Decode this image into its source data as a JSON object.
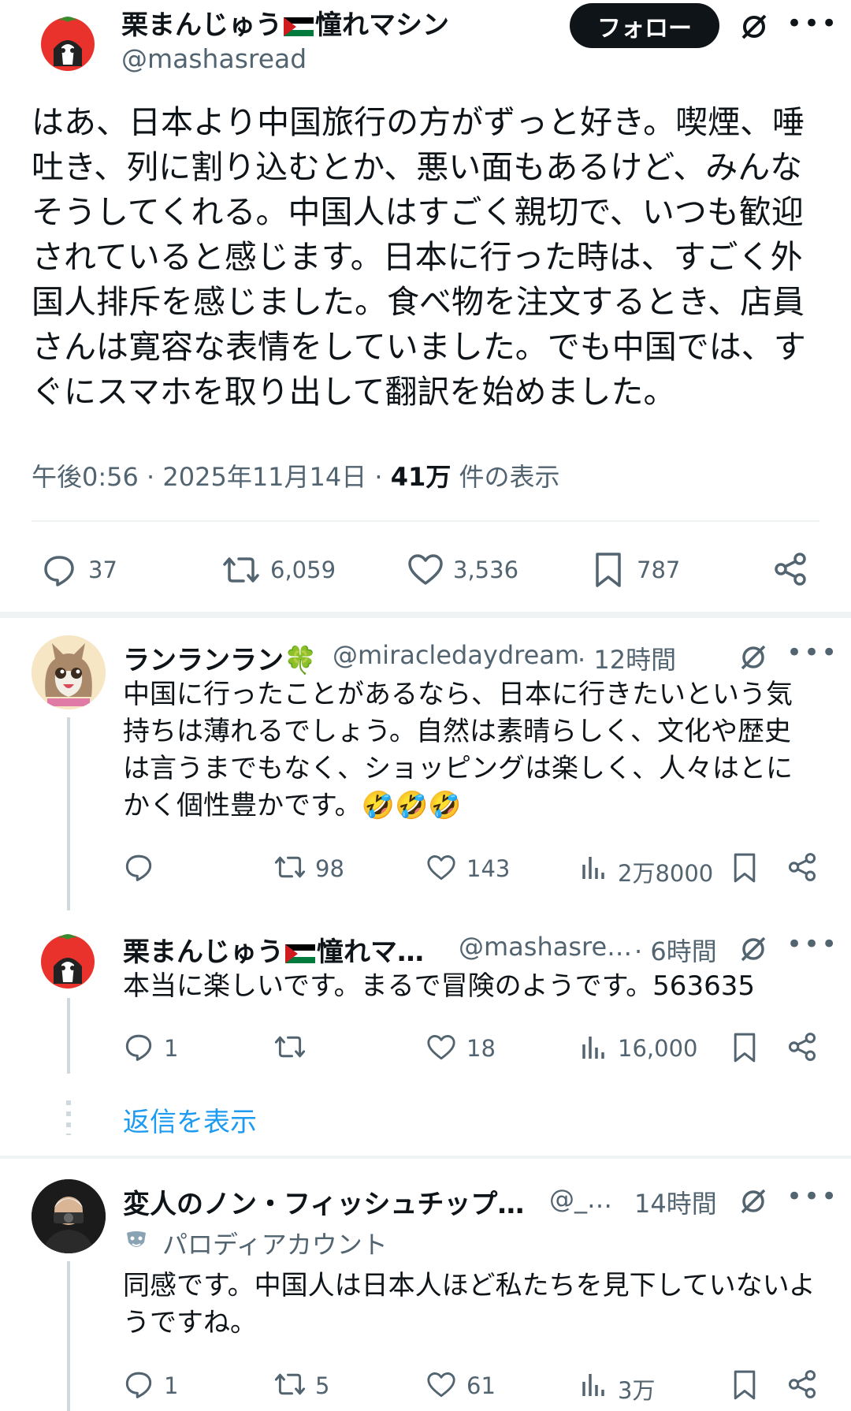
{
  "main_post": {
    "author_name_part1": "栗まんじゅう",
    "author_name_part2": "憧れマシン",
    "handle": "@mashasread",
    "follow_label": "フォロー",
    "text": "はあ、日本より中国旅行の方がずっと好き。喫煙、唾吐き、列に割り込むとか、悪い面もあるけど、みんなそうしてくれる。中国人はすごく親切で、いつも歓迎されていると感じます。日本に行った時は、すごく外国人排斥を感じました。食べ物を注文するとき、店員さんは寛容な表情をしていました。でも中国では、すぐにスマホを取り出して翻訳を始めました。",
    "time": "午後0:56 · 2025年11月14日 · ",
    "views_count": "41万",
    "views_label": " 件の表示",
    "replies": "37",
    "reposts": "6,059",
    "likes": "3,536",
    "bookmarks": "787"
  },
  "replies": [
    {
      "name": "ランランラン",
      "name_emoji": "🍀",
      "handle": "@miracledaydream",
      "time": "· 12時間",
      "text": "中国に行ったことがあるなら、日本に行きたいという気持ちは薄れるでしょう。自然は素晴らしく、文化や歴史は言うまでもなく、ショッピングは楽しく、人々はとにかく個性豊かです。",
      "emojis": "🤣🤣🤣",
      "replies": "",
      "reposts": "98",
      "likes": "143",
      "views": "2万8000"
    },
    {
      "name_part1": "栗まんじゅう",
      "name_part2": "憧れマ…",
      "handle": "@mashasre…",
      "time": "· 6時間",
      "text": "本当に楽しいです。まるで冒険のようです。563635",
      "replies": "1",
      "reposts": "",
      "likes": "18",
      "views": "16,000",
      "show_replies": "返信を表示"
    },
    {
      "name": "変人のノン・フィッシュチップ…",
      "handle": "@_…",
      "time": "14時間",
      "parody_label": "パロディアカウント",
      "text": "同感です。中国人は日本人ほど私たちを見下していないようですね。",
      "replies": "1",
      "reposts": "5",
      "likes": "61",
      "views": "3万"
    }
  ],
  "icons": {
    "more": "•••",
    "grok": "grok-icon",
    "reply": "reply-icon",
    "repost": "repost-icon",
    "like": "heart-icon",
    "bookmark": "bookmark-icon",
    "share": "share-icon",
    "views": "views-icon"
  },
  "colors": {
    "text": "#0f1419",
    "secondary": "#536471",
    "link": "#1d9bf0",
    "divider": "#eff3f4"
  }
}
